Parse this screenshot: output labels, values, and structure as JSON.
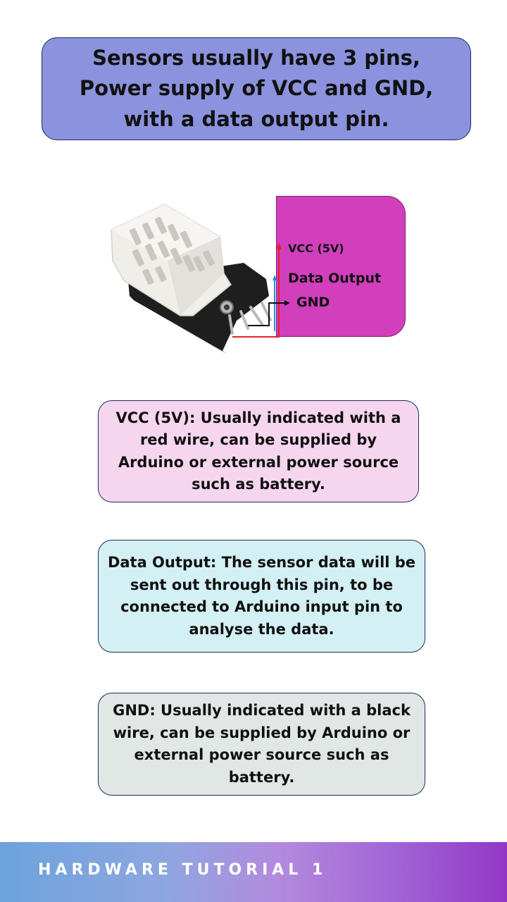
{
  "title": "Sensors usually have 3 pins, Power supply of VCC and GND, with a data output pin.",
  "diagram": {
    "vcc_label": "VCC (5V)",
    "data_label": "Data Output",
    "gnd_label": "GND"
  },
  "descriptions": {
    "vcc": "VCC (5V): Usually indicated with a red wire, can be supplied by Arduino or external power source such as battery.",
    "data": "Data Output: The sensor data will be sent out through this pin, to be connected to Arduino input pin to analyse the data.",
    "gnd": "GND: Usually indicated with a black wire, can be supplied by Arduino or external power source such as battery."
  },
  "footer": {
    "text": "HARDWARE TUTORIAL 1"
  },
  "colors": {
    "title_bg": "#8b93df",
    "panel": "#d23fbd",
    "vcc_bg": "#f6d6ef",
    "data_bg": "#d3f0f4",
    "gnd_bg": "#e1e7e5",
    "vcc_wire": "#e5202a",
    "gnd_wire": "#111111",
    "data_wire": "#2a8bd8"
  }
}
